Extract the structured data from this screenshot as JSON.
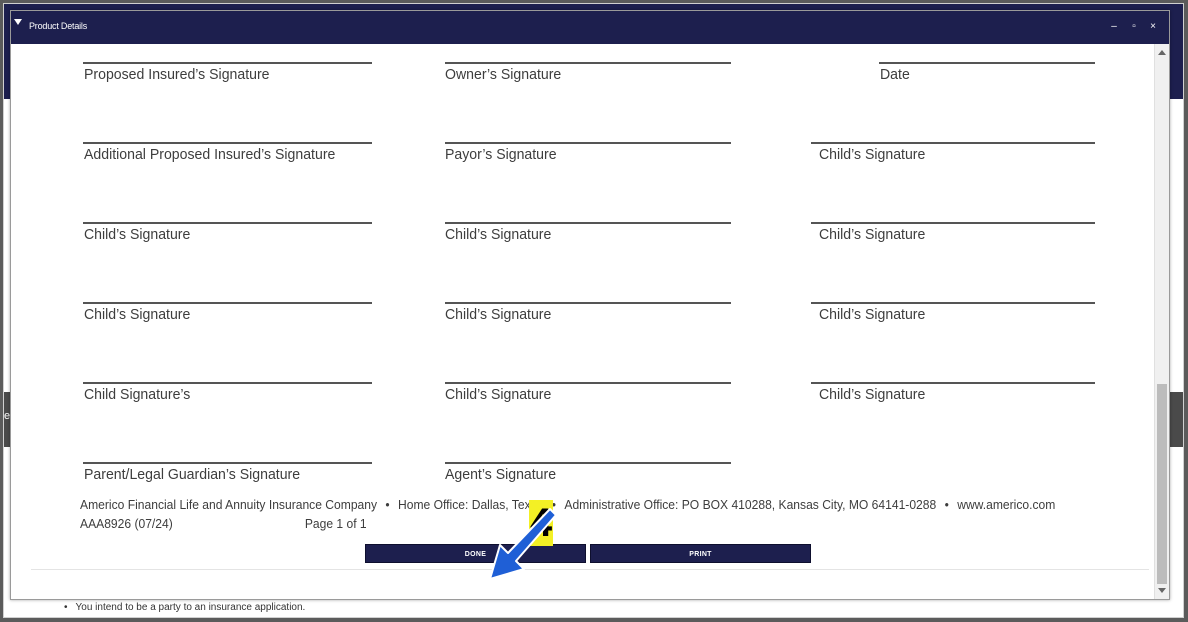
{
  "background": {
    "side_text": "etail",
    "bullet_text": "You intend to be a party to an insurance application."
  },
  "window": {
    "title": "Product Details",
    "controls": {
      "minimize": "–",
      "maximize": "▫",
      "close": "×"
    }
  },
  "signatures": {
    "row1": [
      "Proposed Insured’s Signature",
      "Owner’s Signature",
      "Date"
    ],
    "row2": [
      "Additional Proposed Insured’s Signature",
      "Payor’s Signature",
      "Child’s Signature"
    ],
    "row3": [
      "Child’s Signature",
      "Child’s Signature",
      "Child’s Signature"
    ],
    "row4": [
      "Child’s Signature",
      "Child’s Signature",
      "Child’s Signature"
    ],
    "row5": [
      "Child Signature’s",
      "Child’s Signature",
      "Child’s Signature"
    ],
    "row6": [
      "Parent/Legal Guardian’s Signature",
      "Agent’s Signature"
    ]
  },
  "footer": {
    "company": "Americo Financial Life and Annuity Insurance Company",
    "home_office": "Home Office: Dallas, Texas",
    "admin_office": "Administrative Office: PO BOX 410288, Kansas City, MO 64141-0288",
    "website": "www.americo.com",
    "form_code": "AAA8926 (07/24)",
    "page": "Page 1 of 1",
    "separator": "•"
  },
  "buttons": {
    "done": "DONE",
    "print": "PRINT"
  },
  "annotation": {
    "step": "4",
    "badge_color": "#f3f025",
    "arrow_color": "#1f5fd6"
  },
  "colors": {
    "navy": "#1d1f4e"
  }
}
